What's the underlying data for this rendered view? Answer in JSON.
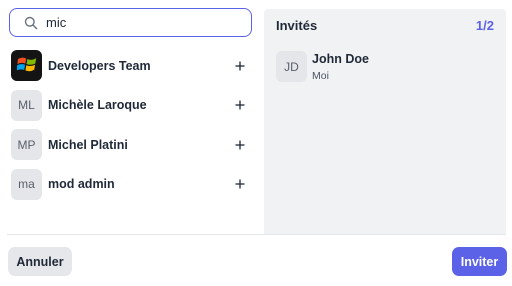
{
  "search": {
    "value": "mic",
    "icon": "search-icon"
  },
  "users": [
    {
      "name": "Developers Team",
      "avatar_type": "logo",
      "avatar_icon": "windows-logo-icon",
      "action_icon": "plus-icon"
    },
    {
      "name": "Michèle Laroque",
      "avatar_type": "initials",
      "initials": "ML",
      "action_icon": "plus-icon"
    },
    {
      "name": "Michel Platini",
      "avatar_type": "initials",
      "initials": "MP",
      "action_icon": "plus-icon"
    },
    {
      "name": "mod admin",
      "avatar_type": "initials",
      "initials": "ma",
      "action_icon": "plus-icon"
    }
  ],
  "invitees_panel": {
    "title": "Invités",
    "count": "1/2",
    "invitees": [
      {
        "initials": "JD",
        "name": "John Doe",
        "subtitle": "Moi"
      }
    ]
  },
  "footer": {
    "cancel_label": "Annuler",
    "invite_label": "Inviter"
  },
  "colors": {
    "accent": "#5b62e8",
    "avatar_bg": "#e5e6ea",
    "panel_bg": "#f1f2f4"
  }
}
